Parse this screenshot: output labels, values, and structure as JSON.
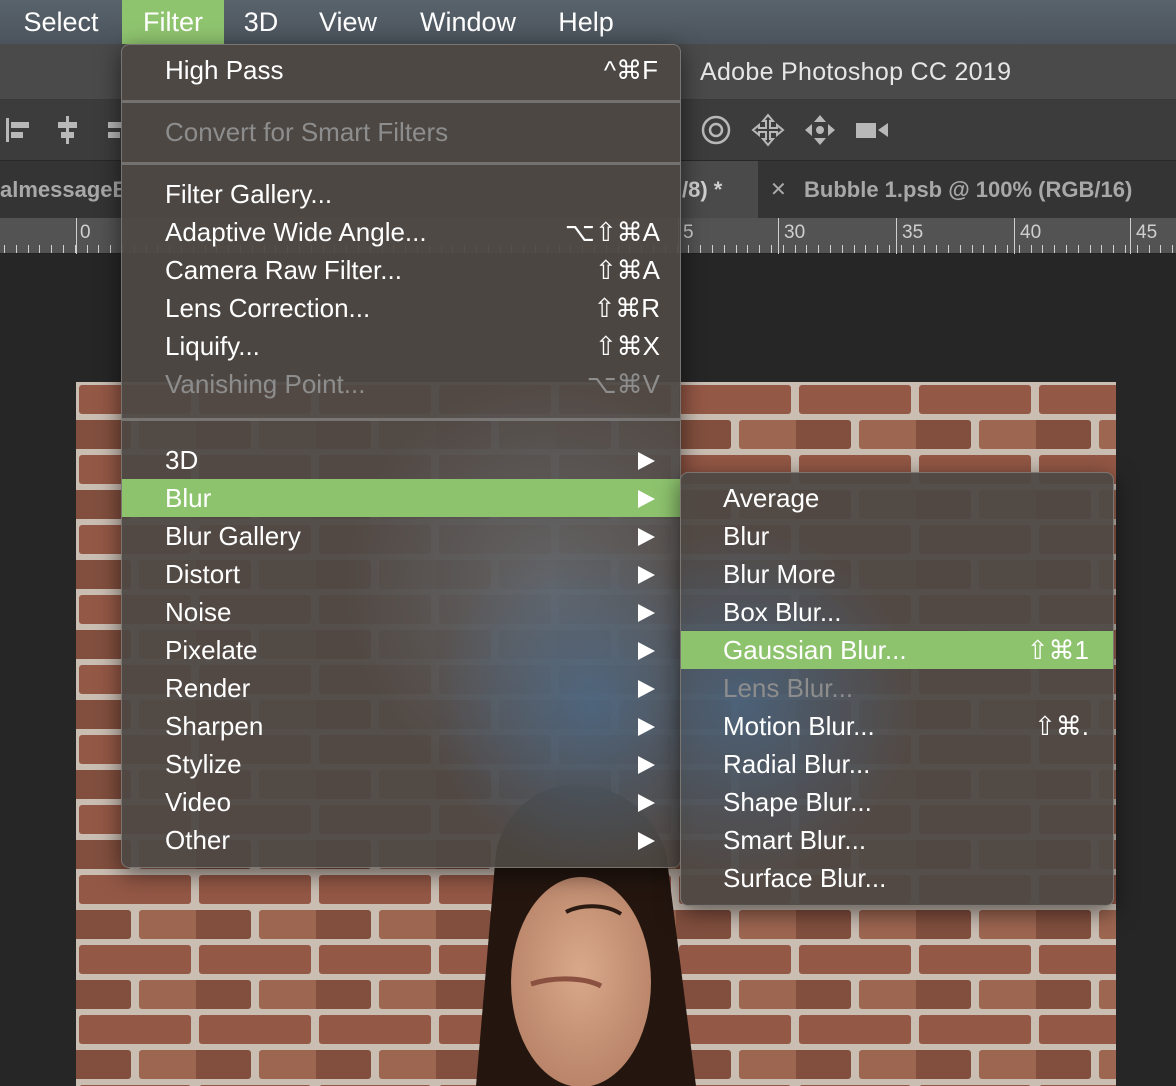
{
  "menubar": {
    "items": [
      "Select",
      "Filter",
      "3D",
      "View",
      "Window",
      "Help"
    ]
  },
  "app": {
    "title": "Adobe Photoshop CC 2019"
  },
  "tabs": {
    "left_partial": "almessageB",
    "middle_partial": "/8) *",
    "right": "Bubble 1.psb @ 100% (RGB/16)"
  },
  "ruler": {
    "labels": [
      "0",
      "5",
      "30",
      "35",
      "40",
      "45"
    ]
  },
  "filter_menu": {
    "top_items": [
      {
        "label": "High Pass",
        "shortcut": "^⌘F",
        "disabled": false
      }
    ],
    "convert_item": {
      "label": "Convert for Smart Filters",
      "disabled": true
    },
    "gallery_items": [
      {
        "label": "Filter Gallery...",
        "shortcut": "",
        "disabled": false
      },
      {
        "label": "Adaptive Wide Angle...",
        "shortcut": "⌥⇧⌘A",
        "disabled": false
      },
      {
        "label": "Camera Raw Filter...",
        "shortcut": "⇧⌘A",
        "disabled": false
      },
      {
        "label": "Lens Correction...",
        "shortcut": "⇧⌘R",
        "disabled": false
      },
      {
        "label": "Liquify...",
        "shortcut": "⇧⌘X",
        "disabled": false
      },
      {
        "label": "Vanishing Point...",
        "shortcut": "⌥⌘V",
        "disabled": true
      }
    ],
    "submenu_items": [
      {
        "label": "3D"
      },
      {
        "label": "Blur",
        "highlighted": true
      },
      {
        "label": "Blur Gallery"
      },
      {
        "label": "Distort"
      },
      {
        "label": "Noise"
      },
      {
        "label": "Pixelate"
      },
      {
        "label": "Render"
      },
      {
        "label": "Sharpen"
      },
      {
        "label": "Stylize"
      },
      {
        "label": "Video"
      },
      {
        "label": "Other"
      }
    ]
  },
  "blur_submenu": {
    "items": [
      {
        "label": "Average",
        "shortcut": ""
      },
      {
        "label": "Blur",
        "shortcut": ""
      },
      {
        "label": "Blur More",
        "shortcut": ""
      },
      {
        "label": "Box Blur...",
        "shortcut": ""
      },
      {
        "label": "Gaussian Blur...",
        "shortcut": "⇧⌘1",
        "highlighted": true
      },
      {
        "label": "Lens Blur...",
        "shortcut": "",
        "disabled": true
      },
      {
        "label": "Motion Blur...",
        "shortcut": "⇧⌘."
      },
      {
        "label": "Radial Blur...",
        "shortcut": ""
      },
      {
        "label": "Shape Blur...",
        "shortcut": ""
      },
      {
        "label": "Smart Blur...",
        "shortcut": ""
      },
      {
        "label": "Surface Blur...",
        "shortcut": ""
      }
    ]
  },
  "colors": {
    "menu_highlight": "#8ec36e",
    "menubar_bg": "#525c64"
  }
}
